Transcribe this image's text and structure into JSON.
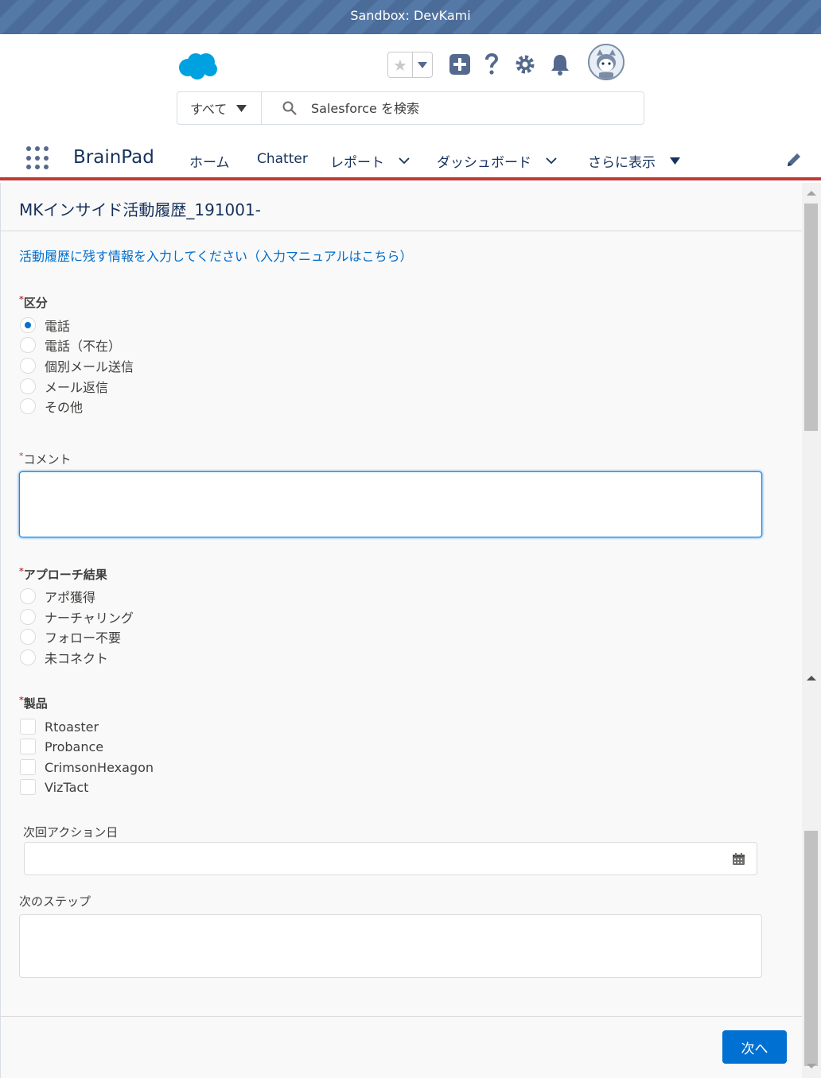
{
  "window": {
    "banner": "Sandbox: DevKami"
  },
  "header": {
    "search_scope": "すべて",
    "search_placeholder": "Salesforce を検索"
  },
  "app_nav": {
    "app_name": "BrainPad",
    "items": [
      {
        "label": "ホーム"
      },
      {
        "label": "Chatter"
      },
      {
        "label": "レポート"
      },
      {
        "label": "ダッシュボード"
      },
      {
        "label": "さらに表示"
      }
    ]
  },
  "form": {
    "title": "MKインサイド活動履歴_191001-",
    "instructions": "活動履歴に残す情報を入力してください（入力マニュアルはこちら）",
    "category": {
      "label": "区分",
      "options": [
        "電話",
        "電話（不在）",
        "個別メール送信",
        "メール返信",
        "その他"
      ],
      "selected_index": 0
    },
    "comment": {
      "label": "コメント",
      "value": ""
    },
    "approach_result": {
      "label": "アプローチ結果",
      "options": [
        "アポ獲得",
        "ナーチャリング",
        "フォロー不要",
        "未コネクト"
      ]
    },
    "products": {
      "label": "製品",
      "options": [
        "Rtoaster",
        "Probance",
        "CrimsonHexagon",
        "VizTact"
      ]
    },
    "next_action_date": {
      "label": "次回アクション日",
      "value": ""
    },
    "next_step": {
      "label": "次のステップ",
      "value": ""
    },
    "next_button": "次へ"
  },
  "colors": {
    "accent": "#0070d2",
    "nav_underline": "#c23934",
    "banner": "#4b6c98"
  }
}
